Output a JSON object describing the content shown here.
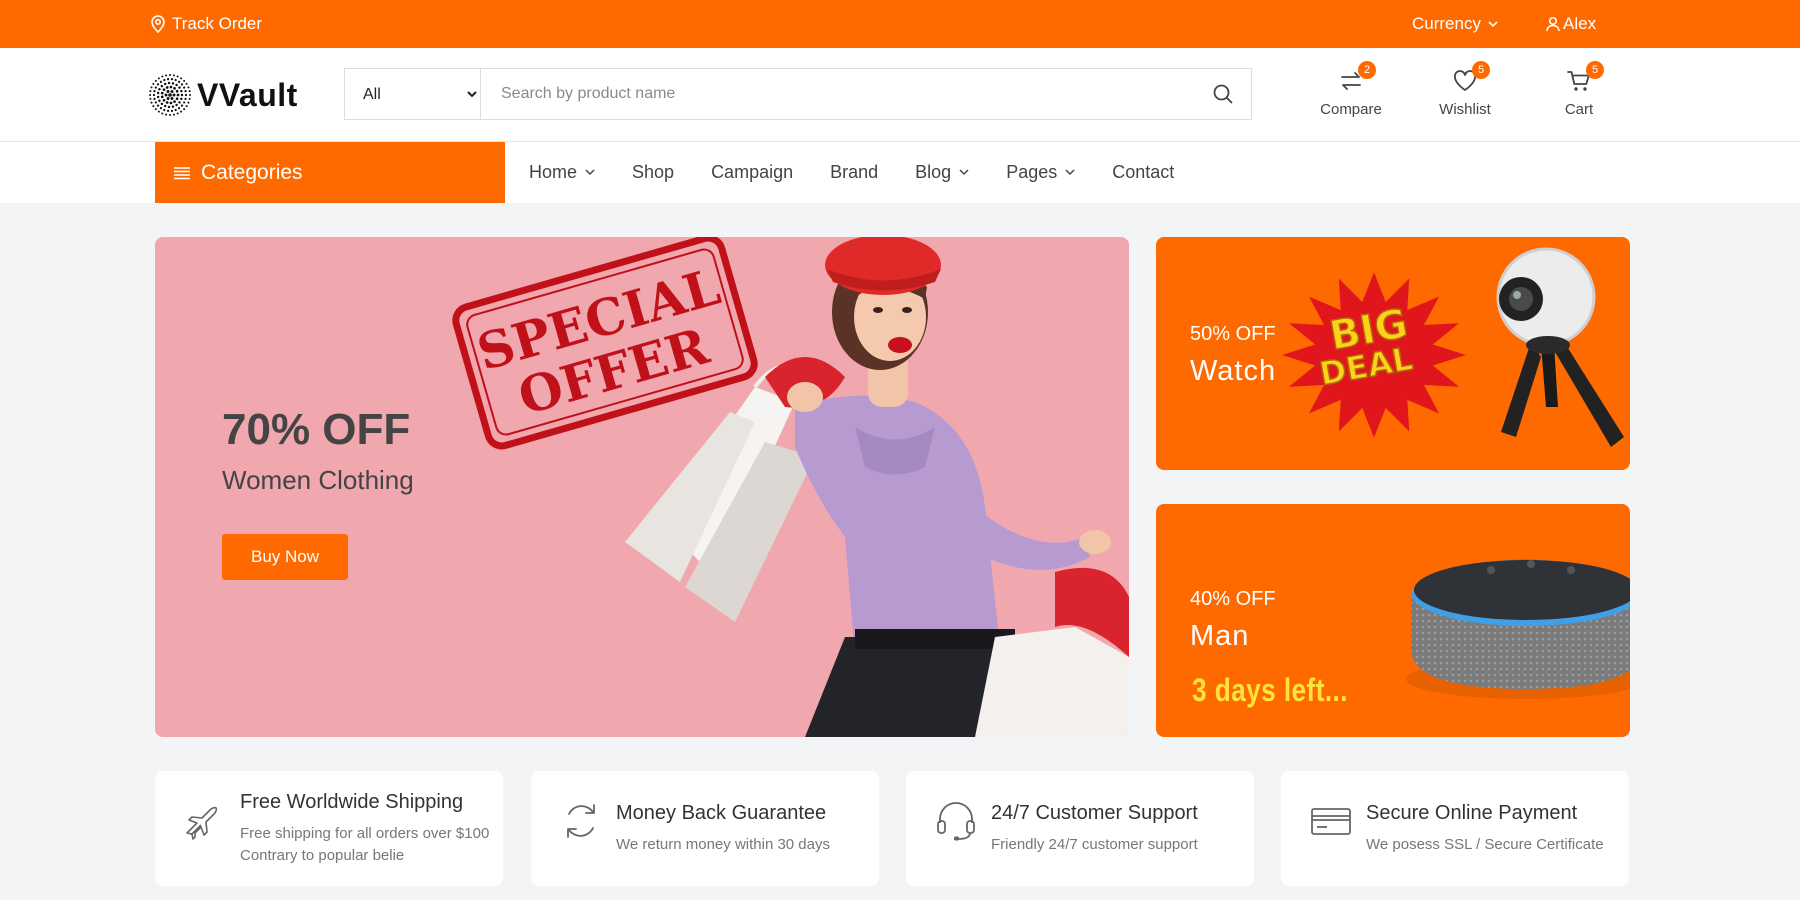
{
  "topbar": {
    "track_order": "Track Order",
    "currency": "Currency",
    "user": "Alex"
  },
  "header": {
    "brand": "VVault",
    "search": {
      "category_selected": "All",
      "placeholder": "Search by product name"
    },
    "icons": [
      {
        "label": "Compare",
        "count": "2",
        "icon": "compare-icon"
      },
      {
        "label": "Wishlist",
        "count": "5",
        "icon": "heart-icon"
      },
      {
        "label": "Cart",
        "count": "5",
        "icon": "cart-icon"
      }
    ]
  },
  "nav": {
    "categories_label": "Categories",
    "items": [
      "Home",
      "Shop",
      "Campaign",
      "Brand",
      "Blog",
      "Pages",
      "Contact"
    ]
  },
  "main_banner": {
    "discount": "70% OFF",
    "subtitle": "Women Clothing",
    "stamp_line1": "SPECIAL",
    "stamp_line2": "OFFER",
    "button": "Buy Now",
    "background_color": "#f1a7ae"
  },
  "side_banners": [
    {
      "discount": "50% OFF",
      "title": "Watch",
      "badge_line1": "BIG",
      "badge_line2": "DEAL"
    },
    {
      "discount": "40% OFF",
      "title": "Man",
      "countdown": "3 days left..."
    }
  ],
  "features": [
    {
      "title": "Free Worldwide Shipping",
      "description": "Free shipping for all orders over $100 Contrary to popular belie",
      "icon": "plane-icon"
    },
    {
      "title": "Money Back Guarantee",
      "description": "We return money within 30 days",
      "icon": "refresh-icon"
    },
    {
      "title": "24/7 Customer Support",
      "description": "Friendly 24/7 customer support",
      "icon": "headset-icon"
    },
    {
      "title": "Secure Online Payment",
      "description": "We posess SSL / Secure Certificate",
      "icon": "credit-card-icon"
    }
  ],
  "colors": {
    "accent": "#ff6a00",
    "countdown": "#ffe23a",
    "stamp": "#c0101a"
  }
}
